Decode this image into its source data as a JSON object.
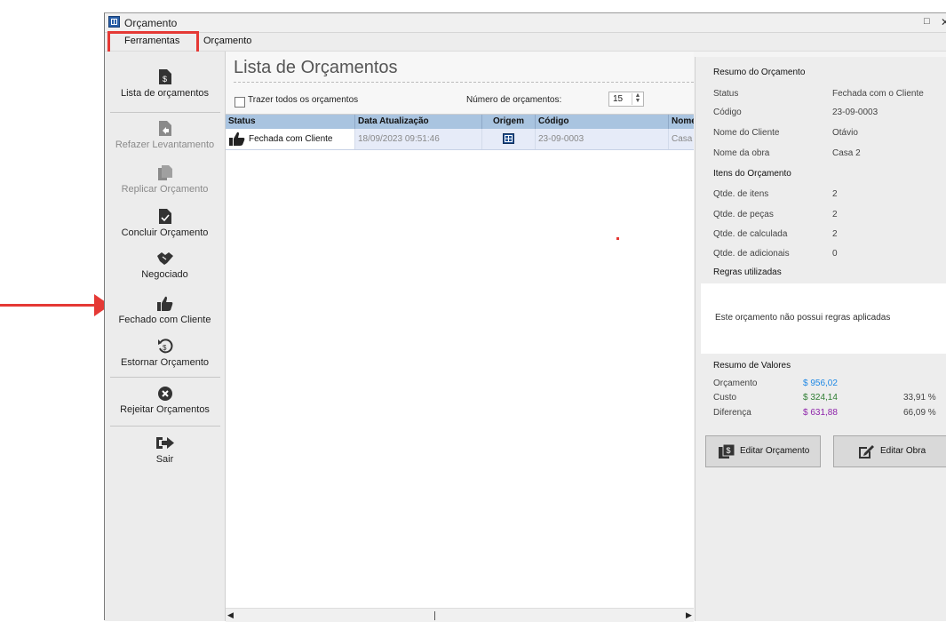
{
  "window": {
    "title": "Orçamento",
    "maximize_icon": "maximize-icon",
    "close_icon": "close-icon"
  },
  "menu": {
    "items": [
      "Ferramentas",
      "Orçamento"
    ]
  },
  "sidebar": {
    "items": [
      {
        "label": "Lista de orçamentos",
        "icon": "budget-list-icon",
        "enabled": true
      },
      {
        "label": "Refazer Levantamento",
        "icon": "redo-survey-icon",
        "enabled": false
      },
      {
        "label": "Replicar Orçamento",
        "icon": "replicate-icon",
        "enabled": false
      },
      {
        "label": "Concluir Orçamento",
        "icon": "conclude-icon",
        "enabled": true
      },
      {
        "label": "Negociado",
        "icon": "handshake-icon",
        "enabled": true
      },
      {
        "label": "Fechado com Cliente",
        "icon": "thumbs-up-icon",
        "enabled": true
      },
      {
        "label": "Estornar Orçamento",
        "icon": "refund-icon",
        "enabled": true
      },
      {
        "label": "Rejeitar Orçamentos",
        "icon": "reject-icon",
        "enabled": true
      },
      {
        "label": "Sair",
        "icon": "exit-icon",
        "enabled": true
      }
    ]
  },
  "list": {
    "title": "Lista de Orçamentos",
    "checkbox_label": "Trazer todos os orçamentos",
    "count_label": "Número de orçamentos:",
    "count_value": "15",
    "columns": [
      "Status",
      "Data Atualização",
      "Origem",
      "Código",
      "Nome"
    ],
    "rows": [
      {
        "status": "Fechada com Cliente",
        "date": "18/09/2023  09:51:46",
        "origem_icon": "grid-icon",
        "codigo": "23-09-0003",
        "nome": "Casa"
      }
    ]
  },
  "summary": {
    "header": "Resumo do Orçamento",
    "fields": [
      {
        "label": "Status",
        "value": "Fechada com o Cliente"
      },
      {
        "label": "Código",
        "value": "23-09-0003"
      },
      {
        "label": "Nome do Cliente",
        "value": "Otávio"
      },
      {
        "label": "Nome da obra",
        "value": "Casa 2"
      }
    ],
    "items_header": "Itens do Orçamento",
    "items": [
      {
        "label": "Qtde. de itens",
        "value": "2"
      },
      {
        "label": "Qtde. de peças",
        "value": "2"
      },
      {
        "label": "Qtde. de calculada",
        "value": "2"
      },
      {
        "label": "Qtde. de adicionais",
        "value": "0"
      }
    ],
    "rules_header": "Regras utilizadas",
    "rules_text": "Este orçamento não possui regras aplicadas",
    "values_header": "Resumo de Valores",
    "values": [
      {
        "label": "Orçamento",
        "value": "$ 956,02",
        "pct": "",
        "color": "#1e88e5"
      },
      {
        "label": "Custo",
        "value": "$ 324,14",
        "pct": "33,91 %",
        "color": "#2e7d32"
      },
      {
        "label": "Diferença",
        "value": "$ 631,88",
        "pct": "66,09 %",
        "color": "#8e24aa"
      }
    ],
    "edit_budget_label": "Editar Orçamento",
    "edit_work_label": "Editar Obra"
  },
  "colors": {
    "highlight": "#e53935",
    "header_blue": "#a9c4e0"
  }
}
